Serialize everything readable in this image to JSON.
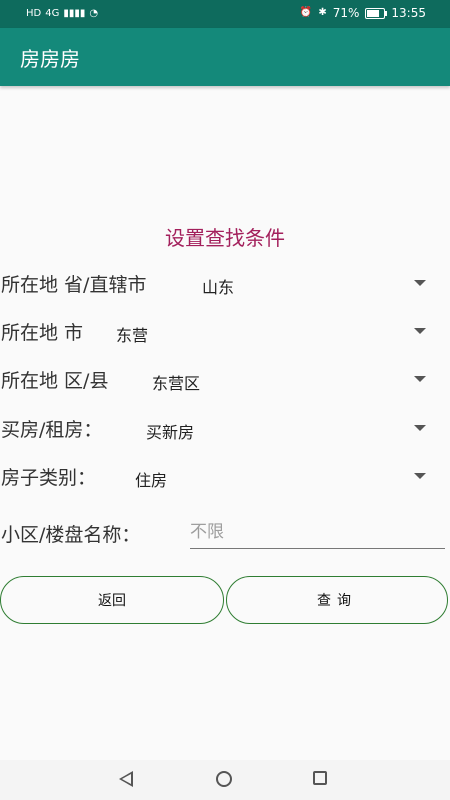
{
  "status_bar": {
    "left_icons": [
      "HD",
      "4G",
      "signal-icon",
      "wifi-icon"
    ],
    "battery_text": "71%",
    "time": "13:55",
    "battery_level": 0.71
  },
  "app_bar": {
    "title": "房房房"
  },
  "form": {
    "heading": "设置查找条件",
    "rows": [
      {
        "label": "所在地 省/直辖市",
        "value": "山东"
      },
      {
        "label": "所在地 市",
        "value": "东营"
      },
      {
        "label": "所在地 区/县",
        "value": "东营区"
      },
      {
        "label": "买房/租房：",
        "value": "买新房"
      },
      {
        "label": "房子类别：",
        "value": "住房"
      }
    ],
    "community_label": "小区/楼盘名称：",
    "community_placeholder": "不限"
  },
  "buttons": {
    "back": "返回",
    "query": "查询"
  },
  "colors": {
    "status": "#0e6b5d",
    "appbar": "#14897a",
    "heading": "#a3205c",
    "button_border": "#2f7d32"
  }
}
